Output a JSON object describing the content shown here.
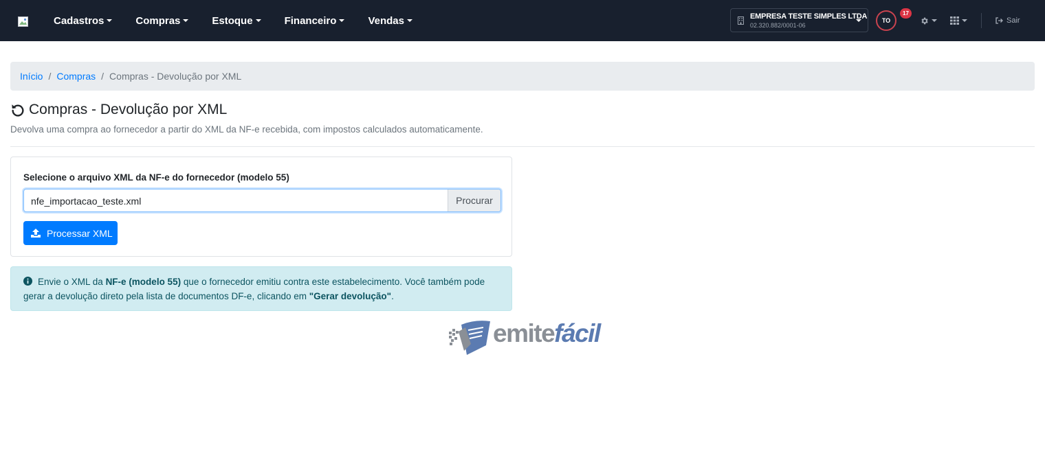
{
  "navbar": {
    "menu": [
      {
        "label": "Cadastros"
      },
      {
        "label": "Compras"
      },
      {
        "label": "Estoque"
      },
      {
        "label": "Financeiro"
      },
      {
        "label": "Vendas"
      }
    ],
    "company": {
      "name": "EMPRESA TESTE SIMPLES LTDA",
      "cnpj": "02.320.882/0001-06"
    },
    "user_initials": "TO",
    "notifications_count": "17",
    "logout_label": "Sair",
    "bg_color": "#18202e"
  },
  "breadcrumb": {
    "items": [
      {
        "label": "Início"
      },
      {
        "label": "Compras"
      }
    ],
    "current": "Compras - Devolução por XML"
  },
  "page": {
    "title": "Compras - Devolução por XML",
    "subtitle": "Devolva uma compra ao fornecedor a partir do XML da NF-e recebida, com impostos calculados automaticamente."
  },
  "form": {
    "label": "Selecione o arquivo XML da NF-e do fornecedor (modelo 55)",
    "file_value": "nfe_importacao_teste.xml",
    "browse_label": "Procurar",
    "submit_label": "Processar XML",
    "primary_color": "#007bff"
  },
  "alert": {
    "text_1": "Envie o XML da ",
    "bold_1": "NF-e (modelo 55)",
    "text_2": " que o fornecedor emitiu contra este estabelecimento. Você também pode gerar a devolução direto pela lista de documentos DF-e, clicando em ",
    "bold_2": "\"Gerar devolução\"",
    "text_3": "."
  },
  "brand": {
    "part_1": "emite",
    "part_2": "fácil"
  }
}
